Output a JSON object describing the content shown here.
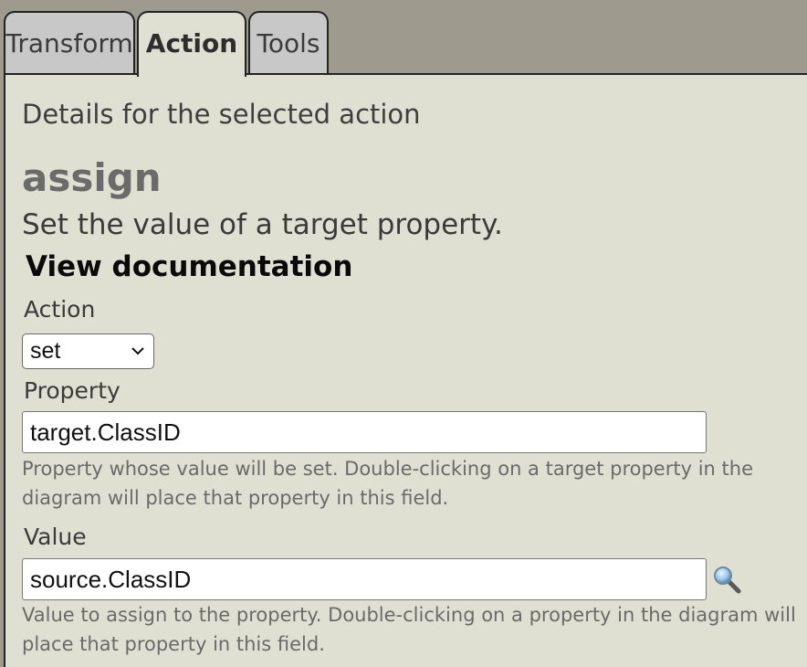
{
  "tabs": [
    {
      "label": "Transform",
      "active": false
    },
    {
      "label": "Action",
      "active": true
    },
    {
      "label": "Tools",
      "active": false
    }
  ],
  "panel": {
    "heading": "Details for the selected action",
    "action_name": "assign",
    "action_description": "Set the value of a target property.",
    "doc_link": "View documentation"
  },
  "action_field": {
    "label": "Action",
    "selected": "set"
  },
  "property_field": {
    "label": "Property",
    "value": "target.ClassID",
    "help": "Property whose value will be set. Double-clicking on a target property in the diagram will place that property in this field."
  },
  "value_field": {
    "label": "Value",
    "value": "source.ClassID",
    "help": "Value to assign to the property. Double-clicking on a property in the diagram will place that property in this field.",
    "icon": "search-icon"
  },
  "colors": {
    "tabbar_bg": "#9e9a8d",
    "panel_bg": "#e0e0d2",
    "inactive_tab_bg": "#c8c8c8",
    "help_text": "#6a6a6a",
    "action_name": "#6b6b6b"
  }
}
